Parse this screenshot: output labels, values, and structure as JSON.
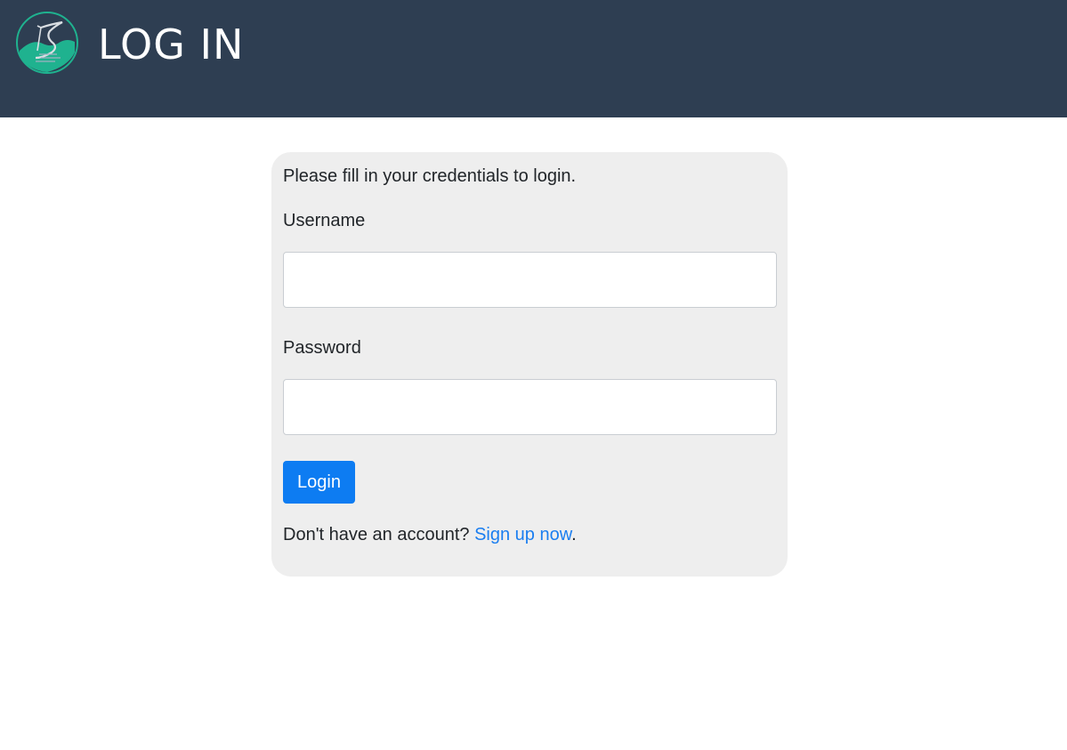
{
  "header": {
    "title": "LOG IN",
    "logo_icon": "road-circle-logo-icon",
    "background_color": "#2e3e52"
  },
  "login_form": {
    "intro": "Please fill in your credentials to login.",
    "username_label": "Username",
    "username_value": "",
    "username_placeholder": "",
    "password_label": "Password",
    "password_value": "",
    "password_placeholder": "",
    "submit_label": "Login",
    "signup_prompt": "Don't have an account?",
    "signup_link": "Sign up now",
    "signup_suffix": "."
  },
  "colors": {
    "accent": "#0d7cf2",
    "link": "#1a7ef0",
    "card_background": "#eeeeee",
    "logo_teal": "#1fb28f"
  }
}
